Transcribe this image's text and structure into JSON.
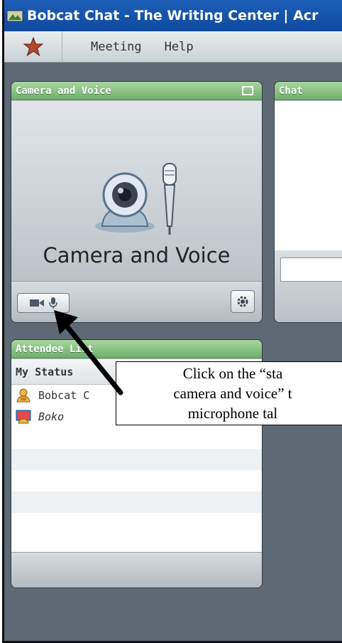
{
  "window": {
    "title": "Bobcat Chat - The Writing Center | Acr"
  },
  "menu": {
    "items": [
      "Meeting",
      "Help"
    ]
  },
  "camera_pod": {
    "title": "Camera and Voice",
    "placeholder_label": "Camera and Voice"
  },
  "chat_pod": {
    "title": "Chat"
  },
  "attendees_pod": {
    "title": "Attendee List",
    "status_label": "My Status",
    "attendees": [
      {
        "name": "Bobcat C",
        "role": "host"
      },
      {
        "name": "Boko",
        "role": "participant"
      }
    ]
  },
  "callout": {
    "lines": [
      "Click on the “sta",
      "camera and voice” t",
      "microphone tal"
    ]
  },
  "colors": {
    "title_bar": "#1d5fb8",
    "pod_header": "#7fbd79",
    "background": "#5d6a74"
  }
}
